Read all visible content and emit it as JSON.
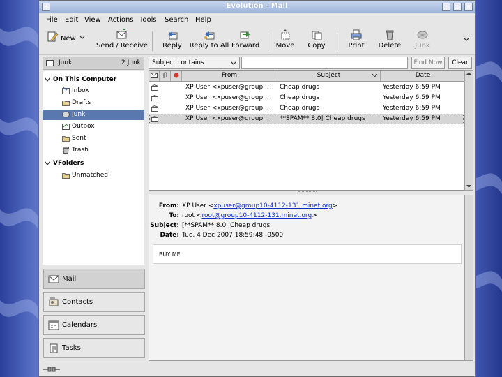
{
  "window": {
    "title": "Evolution - Mail",
    "controls": {
      "minimize": "_",
      "maximize": "□",
      "close": "×"
    }
  },
  "menubar": [
    "File",
    "Edit",
    "View",
    "Actions",
    "Tools",
    "Search",
    "Help"
  ],
  "toolbar": {
    "new_label": "New",
    "send_receive": "Send / Receive",
    "reply": "Reply",
    "reply_all": "Reply to All",
    "forward": "Forward",
    "move": "Move",
    "copy": "Copy",
    "print": "Print",
    "delete": "Delete",
    "junk": "Junk"
  },
  "folder_header": {
    "name": "Junk",
    "count": "2 Junk"
  },
  "folders": {
    "on_this_computer": "On This Computer",
    "items": [
      "Inbox",
      "Drafts",
      "Junk",
      "Outbox",
      "Sent",
      "Trash"
    ],
    "selected": "Junk",
    "vfolders": "VFolders",
    "vfolder_items": [
      "Unmatched"
    ]
  },
  "switcher": {
    "mail": "Mail",
    "contacts": "Contacts",
    "calendars": "Calendars",
    "tasks": "Tasks"
  },
  "search": {
    "combo_label": "Subject contains",
    "find_now": "Find Now",
    "clear": "Clear"
  },
  "message_list": {
    "headers": {
      "from": "From",
      "subject": "Subject",
      "date": "Date"
    },
    "rows": [
      {
        "from": "XP User <xpuser@group...",
        "subject": "Cheap drugs",
        "date": "Yesterday 6:59 PM"
      },
      {
        "from": "XP User <xpuser@group...",
        "subject": "Cheap drugs",
        "date": "Yesterday 6:59 PM"
      },
      {
        "from": "XP User <xpuser@group...",
        "subject": "Cheap drugs",
        "date": "Yesterday 6:59 PM"
      },
      {
        "from": "XP User <xpuser@group...",
        "subject": "**SPAM** 8.0| Cheap drugs",
        "date": "Yesterday 6:59 PM"
      }
    ],
    "selected_index": 3
  },
  "preview": {
    "from_label": "From:",
    "from_name": "XP User <",
    "from_email": "xpuser@group10-4112-131.minet.org",
    "from_close": ">",
    "to_label": "To:",
    "to_name": "root <",
    "to_email": "root@group10-4112-131.minet.org",
    "to_close": ">",
    "subject_label": "Subject:",
    "subject_value": "[**SPAM** 8.0| Cheap drugs",
    "date_label": "Date:",
    "date_value": "Tue, 4 Dec 2007 18:59:48 -0500",
    "body": "BUY ME"
  }
}
